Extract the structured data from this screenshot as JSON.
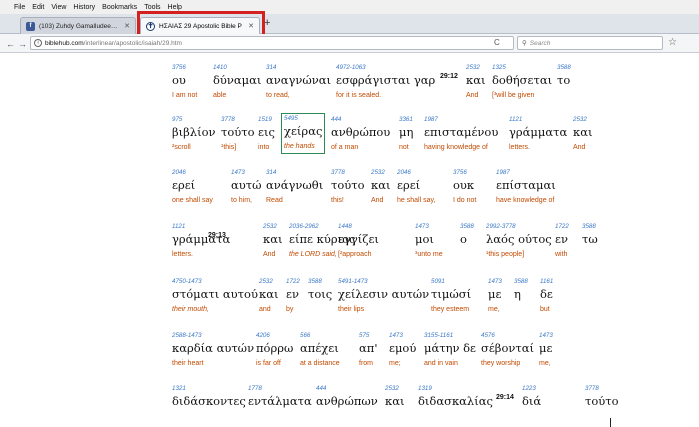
{
  "menubar": [
    "File",
    "Edit",
    "View",
    "History",
    "Bookmarks",
    "Tools",
    "Help"
  ],
  "tabs": [
    {
      "title": "(103) Zuhdy Gamalludeen M",
      "favicon": "facebook-icon",
      "fav_glyph": "f"
    },
    {
      "title": "ΗΣΑΙΑΣ 29 Apostolic Bible P",
      "favicon": "cross-icon",
      "fav_glyph": "✝"
    }
  ],
  "nav": {
    "host": "biblehub.com",
    "path": "/interlinear/apostolic/isaiah/29.htm",
    "search_placeholder": "Search"
  },
  "rows": [
    {
      "words": [
        {
          "s": "3756",
          "g": "ου",
          "e": "I am not"
        },
        {
          "s": "1410",
          "g": "δύναμαι",
          "e": "able"
        },
        {
          "s": "314",
          "g": "αναγνώναι",
          "e": "to read,"
        },
        {
          "s": "4972-1063",
          "g": "εσφράγισται γαρ",
          "e": "for it is sealed."
        },
        {
          "s": "",
          "g": "",
          "e": "",
          "v": "29:12"
        },
        {
          "s": "2532",
          "g": "και",
          "e": "And"
        },
        {
          "s": "1325",
          "g": "δοθήσεται",
          "e": "[³will be given"
        },
        {
          "s": "3588",
          "g": "το",
          "e": ""
        }
      ]
    },
    {
      "words": [
        {
          "s": "975",
          "g": "βιβλίον",
          "e": "²scroll"
        },
        {
          "s": "3778",
          "g": "τούτο",
          "e": "¹this]"
        },
        {
          "s": "1519",
          "g": "εις",
          "e": "into"
        },
        {
          "s": "5495",
          "g": "χείρας",
          "e": "the hands"
        },
        {
          "s": "444",
          "g": "ανθρώπου",
          "e": "of a man"
        },
        {
          "s": "3361",
          "g": "μη",
          "e": "not"
        },
        {
          "s": "1987",
          "g": "επισταμένου",
          "e": "having knowledge of"
        },
        {
          "s": "1121",
          "g": "γράμματα",
          "e": "letters."
        },
        {
          "s": "2532",
          "g": "και",
          "e": "And"
        }
      ]
    },
    {
      "words": [
        {
          "s": "2046",
          "g": "ερεί",
          "e": "one shall say"
        },
        {
          "s": "1473",
          "g": "αυτώ",
          "e": "to him,"
        },
        {
          "s": "314",
          "g": "ανάγνωθι",
          "e": "Read"
        },
        {
          "s": "3778",
          "g": "τούτο",
          "e": "this!"
        },
        {
          "s": "2532",
          "g": "και",
          "e": "And"
        },
        {
          "s": "2046",
          "g": "ερεί",
          "e": "he shall say,"
        },
        {
          "s": "3756",
          "g": "ουκ",
          "e": "I do not"
        },
        {
          "s": "1987",
          "g": "επίσταμαι",
          "e": "have knowledge of"
        }
      ]
    },
    {
      "words": [
        {
          "s": "1121",
          "g": "γράμματα",
          "e": "letters."
        },
        {
          "s": "",
          "g": "",
          "e": "",
          "v": "29:13"
        },
        {
          "s": "2532",
          "g": "και",
          "e": "And"
        },
        {
          "s": "2036-2962",
          "g": "είπε κύριος",
          "e": "the LORD said,"
        },
        {
          "s": "1448",
          "g": "εγγίζει",
          "e": "[²approach"
        },
        {
          "s": "1473",
          "g": "μοι",
          "e": "³unto me"
        },
        {
          "s": "3588",
          "g": "ο",
          "e": ""
        },
        {
          "s": "2992-3778",
          "g": "λαός ούτος",
          "e": "¹this people]"
        },
        {
          "s": "1722",
          "g": "εν",
          "e": "with"
        },
        {
          "s": "3588",
          "g": "τω",
          "e": ""
        }
      ]
    },
    {
      "words": [
        {
          "s": "4750-1473",
          "g": "στόματι αυτού",
          "e": "their mouth,"
        },
        {
          "s": "2532",
          "g": "και",
          "e": "and"
        },
        {
          "s": "1722",
          "g": "εν",
          "e": "by"
        },
        {
          "s": "3588",
          "g": "τοις",
          "e": ""
        },
        {
          "s": "5491-1473",
          "g": "χείλεσιν αυτών",
          "e": "their lips"
        },
        {
          "s": "5091",
          "g": "τιμώσί",
          "e": "they esteem"
        },
        {
          "s": "1473",
          "g": "με",
          "e": "me,"
        },
        {
          "s": "3588",
          "g": "η",
          "e": ""
        },
        {
          "s": "1161",
          "g": "δε",
          "e": "but"
        }
      ]
    },
    {
      "words": [
        {
          "s": "2588-1473",
          "g": "καρδία αυτών",
          "e": "their heart"
        },
        {
          "s": "4206",
          "g": "πόρρω",
          "e": "is far off"
        },
        {
          "s": "566",
          "g": "απέχει",
          "e": "at a distance"
        },
        {
          "s": "575",
          "g": "απ'",
          "e": "from"
        },
        {
          "s": "1473",
          "g": "εμού",
          "e": "me;"
        },
        {
          "s": "3155-1161",
          "g": "μάτην δε",
          "e": "and in vain"
        },
        {
          "s": "4576",
          "g": "σέβονταί",
          "e": "they worship"
        },
        {
          "s": "1473",
          "g": "με",
          "e": "me,"
        }
      ]
    },
    {
      "words": [
        {
          "s": "1321",
          "g": "διδάσκοντες",
          "e": ""
        },
        {
          "s": "1778",
          "g": "εντάλματα",
          "e": ""
        },
        {
          "s": "444",
          "g": "ανθρώπων",
          "e": ""
        },
        {
          "s": "2532",
          "g": "και",
          "e": ""
        },
        {
          "s": "1319",
          "g": "διδασκαλίας",
          "e": ""
        },
        {
          "s": "",
          "g": "",
          "e": "",
          "v": "29:14"
        },
        {
          "s": "1223",
          "g": "διά",
          "e": ""
        },
        {
          "s": "3778",
          "g": "τούτο",
          "e": ""
        }
      ]
    }
  ]
}
